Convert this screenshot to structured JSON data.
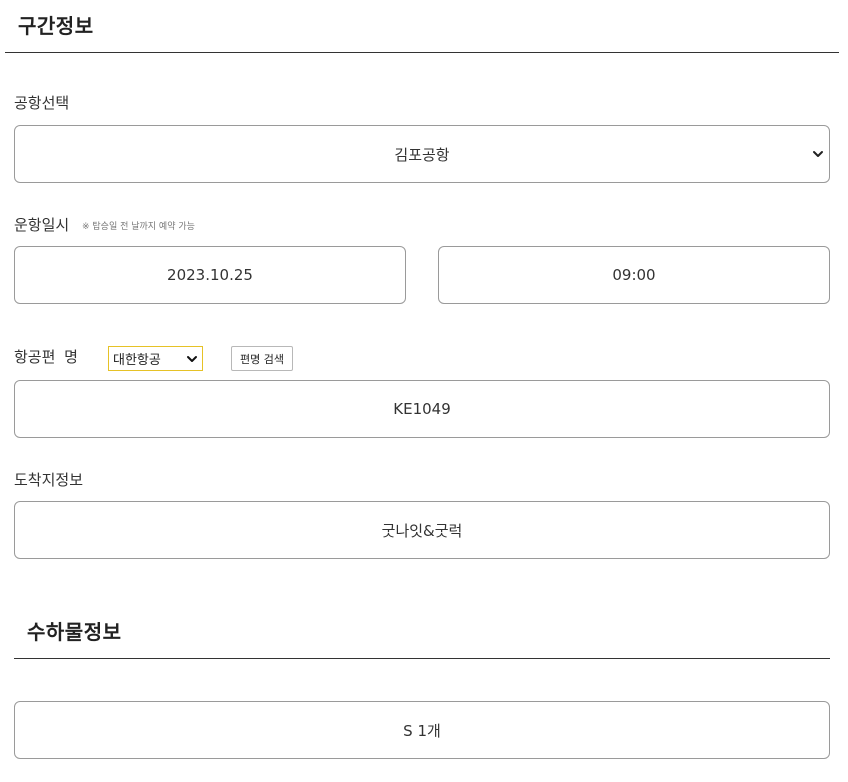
{
  "route_section": {
    "title": "구간정보",
    "airport": {
      "label": "공항선택",
      "selected": "김포공항",
      "icon": "chevron-down-icon"
    },
    "schedule": {
      "label": "운항일시",
      "note": "※ 탑승일 전 날까지 예약 가능",
      "date": "2023.10.25",
      "time": "09:00"
    },
    "flight": {
      "label": "항공편 명",
      "airline_selected": "대한항공",
      "search_button": "편명 검색",
      "flight_number": "KE1049",
      "accent_color": "#e6c227"
    },
    "destination": {
      "label": "도착지정보",
      "value": "굿나잇&굿럭"
    }
  },
  "baggage_section": {
    "title": "수하물정보",
    "value": "S 1개"
  }
}
